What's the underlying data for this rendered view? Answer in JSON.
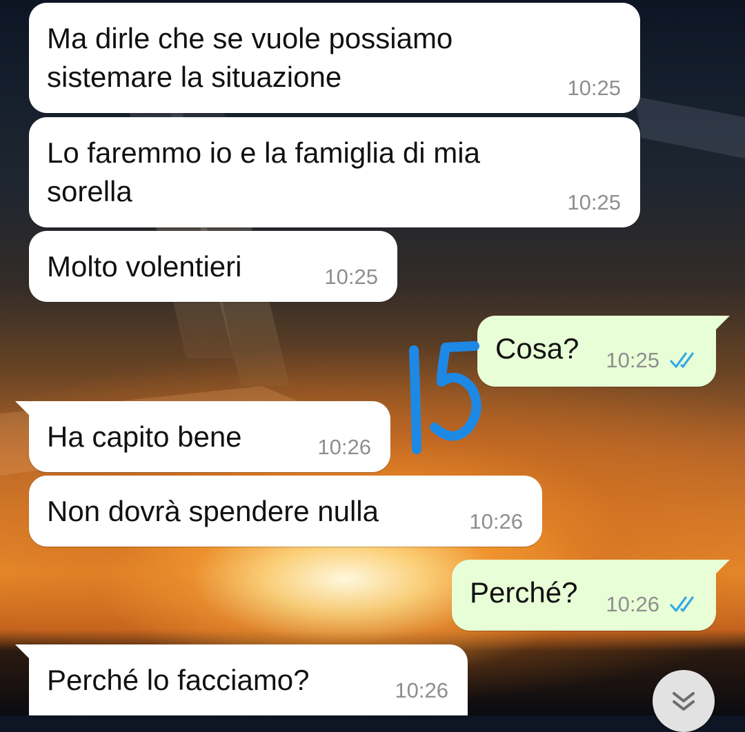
{
  "messages": [
    {
      "direction": "incoming",
      "text": "Ma dirle che se vuole possiamo\nsistemare la situazione",
      "time": "10:25"
    },
    {
      "direction": "incoming",
      "text": "Lo faremmo io e la famiglia di mia\nsorella",
      "time": "10:25"
    },
    {
      "direction": "incoming",
      "text": "Molto volentieri",
      "time": "10:25"
    },
    {
      "direction": "outgoing",
      "text": "Cosa?",
      "time": "10:25",
      "status": "read"
    },
    {
      "direction": "incoming",
      "text": "Ha capito bene",
      "time": "10:26"
    },
    {
      "direction": "incoming",
      "text": "Non dovrà spendere nulla",
      "time": "10:26"
    },
    {
      "direction": "outgoing",
      "text": "Perché?",
      "time": "10:26",
      "status": "read"
    },
    {
      "direction": "incoming",
      "text": "Perché lo facciamo?",
      "time": "10:26"
    }
  ],
  "annotation": {
    "text": "15",
    "color": "#1e88e5"
  },
  "colors": {
    "incoming_bubble": "#ffffff",
    "outgoing_bubble": "#e8fed6",
    "timestamp": "#8e8e8e",
    "read_ticks": "#34a9e4"
  },
  "icons": {
    "read_receipt": "double-check-icon",
    "scroll_down": "double-chevron-down-icon"
  }
}
